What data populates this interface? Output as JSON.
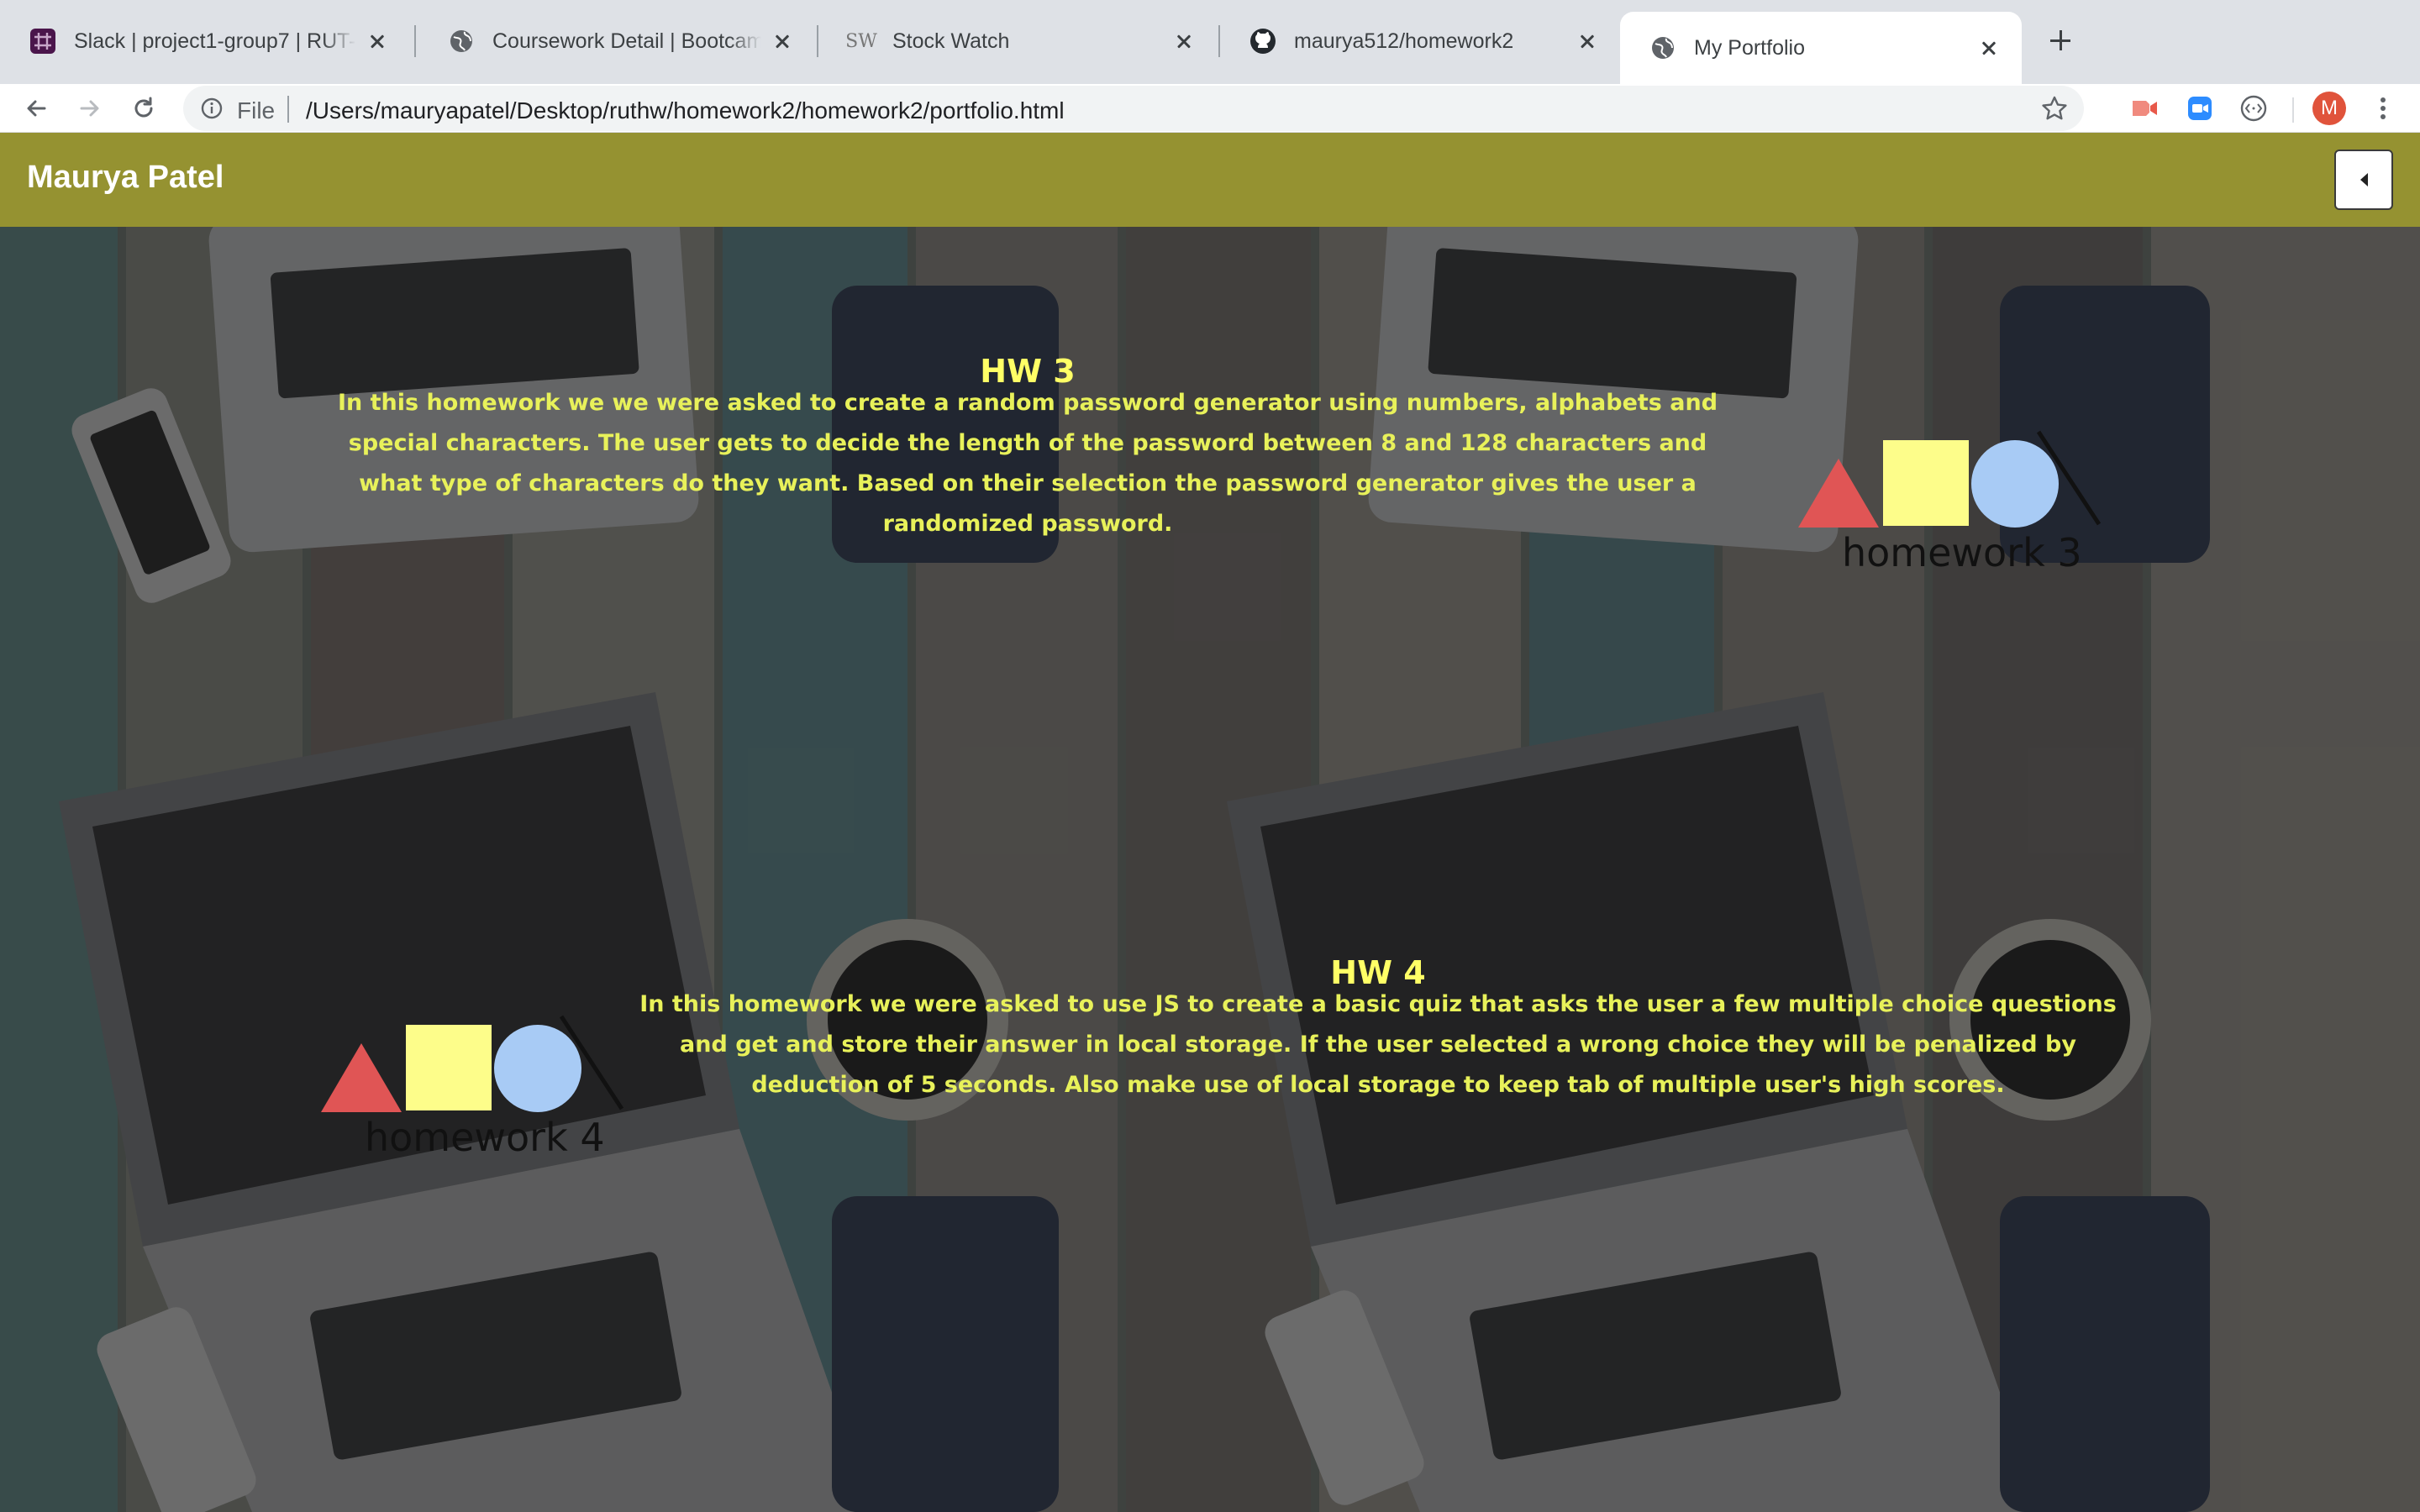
{
  "browser": {
    "tabs": [
      {
        "title": "Slack | project1-group7 | RUT-",
        "icon": "slack-icon",
        "active": false
      },
      {
        "title": "Coursework Detail | Bootcamp",
        "icon": "globe-icon",
        "active": false
      },
      {
        "title": "Stock Watch",
        "icon": "sw-icon",
        "favicon_text": "SW",
        "active": false
      },
      {
        "title": "maurya512/homework2",
        "icon": "github-icon",
        "active": false
      },
      {
        "title": "My Portfolio",
        "icon": "globe-icon",
        "active": true
      }
    ],
    "address": {
      "scheme_label": "File",
      "url": "/Users/mauryapatel/Desktop/ruthw/homework2/homework2/portfolio.html"
    },
    "profile_initial": "M"
  },
  "site": {
    "brand": "Maurya Patel",
    "accent_color": "#959231",
    "text_color": "#ffff66"
  },
  "projects": [
    {
      "title": "HW 3",
      "description": "In this homework we we were asked to create a random password generator using numbers, alphabets and special characters. The user gets to decide the length of the password between 8 and 128 characters and what type of characters do they want. Based on their selection the password generator gives the user a randomized password.",
      "logo_text": "homework 3"
    },
    {
      "title": "HW 4",
      "description": "In this homework we were asked to use JS to create a basic quiz that asks the user a few multiple choice questions and get and store their answer in local storage. If the user selected a wrong choice they will be penalized by deduction of 5 seconds. Also make use of local storage to keep tab of multiple user's high scores.",
      "logo_text": "homework 4"
    }
  ]
}
